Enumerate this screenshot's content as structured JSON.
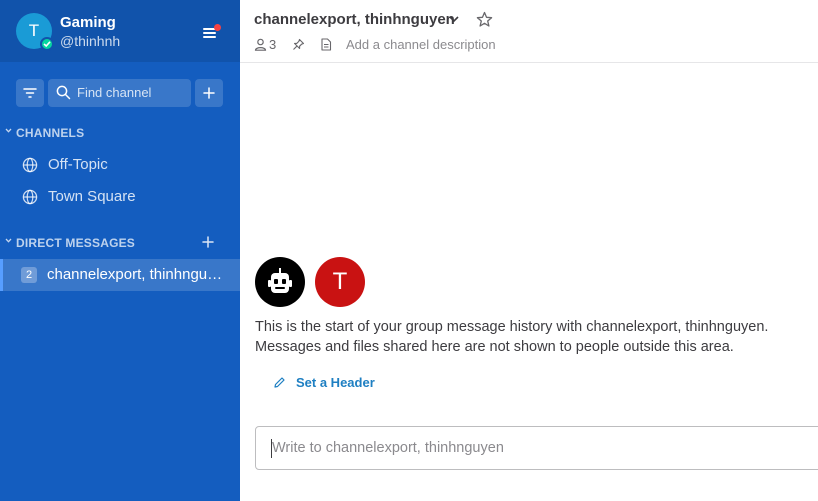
{
  "team": {
    "avatar_letter": "T",
    "name": "Gaming",
    "username": "@thinhnh"
  },
  "search": {
    "placeholder": "Find channel"
  },
  "sections": {
    "channels_label": "CHANNELS",
    "dm_label": "DIRECT MESSAGES"
  },
  "channels": [
    {
      "label": "Off-Topic"
    },
    {
      "label": "Town Square"
    }
  ],
  "direct_messages": [
    {
      "count": "2",
      "label": "channelexport, thinhnguyen"
    }
  ],
  "header": {
    "title": "channelexport, thinhnguyen",
    "member_count": "3",
    "description_placeholder": "Add a channel description"
  },
  "intro": {
    "avatar_letter": "T",
    "text": "This is the start of your group message history with channelexport, thinhnguyen. Messages and files shared here are not shown to people outside this area.",
    "set_header_label": "Set a Header"
  },
  "composer": {
    "placeholder": "Write to channelexport, thinhnguyen"
  },
  "colors": {
    "sidebar": "#145dbf",
    "sidebar_header": "#1153ab",
    "online": "#06d6a0",
    "link": "#1e7fc2",
    "user_avatar": "#c91212"
  }
}
